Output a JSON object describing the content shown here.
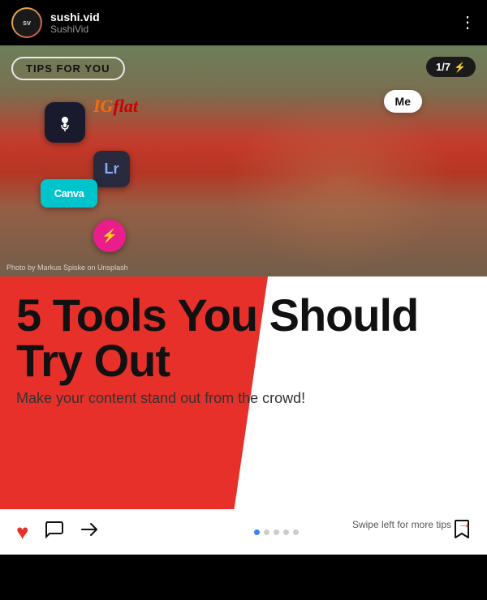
{
  "header": {
    "username": "sushi.vid",
    "display_name": "SushiVid",
    "more_icon": "⋮"
  },
  "tips_banner": {
    "label": "TIPS FOR YOU"
  },
  "counter": {
    "text": "1/7",
    "icon": "⚡"
  },
  "image": {
    "photo_credit": "Photo by Markus Spiske on Unsplash"
  },
  "app_icons": [
    {
      "name": "IGFlat",
      "label": "IGFlat"
    },
    {
      "name": "Mic app",
      "label": "🎙"
    },
    {
      "name": "LightRoom",
      "label": "Lr"
    },
    {
      "name": "Canva",
      "label": "Canva"
    },
    {
      "name": "Pink app",
      "label": "⚡"
    }
  ],
  "me_bubble": {
    "label": "Me"
  },
  "content": {
    "title": "5 Tools You Should Try Out",
    "subtitle": "Make your content stand out from the crowd!",
    "swipe_hint": "Swipe left for more tips"
  },
  "action_bar": {
    "dots": [
      {
        "active": true
      },
      {
        "active": false
      },
      {
        "active": false
      },
      {
        "active": false
      },
      {
        "active": false
      }
    ]
  }
}
